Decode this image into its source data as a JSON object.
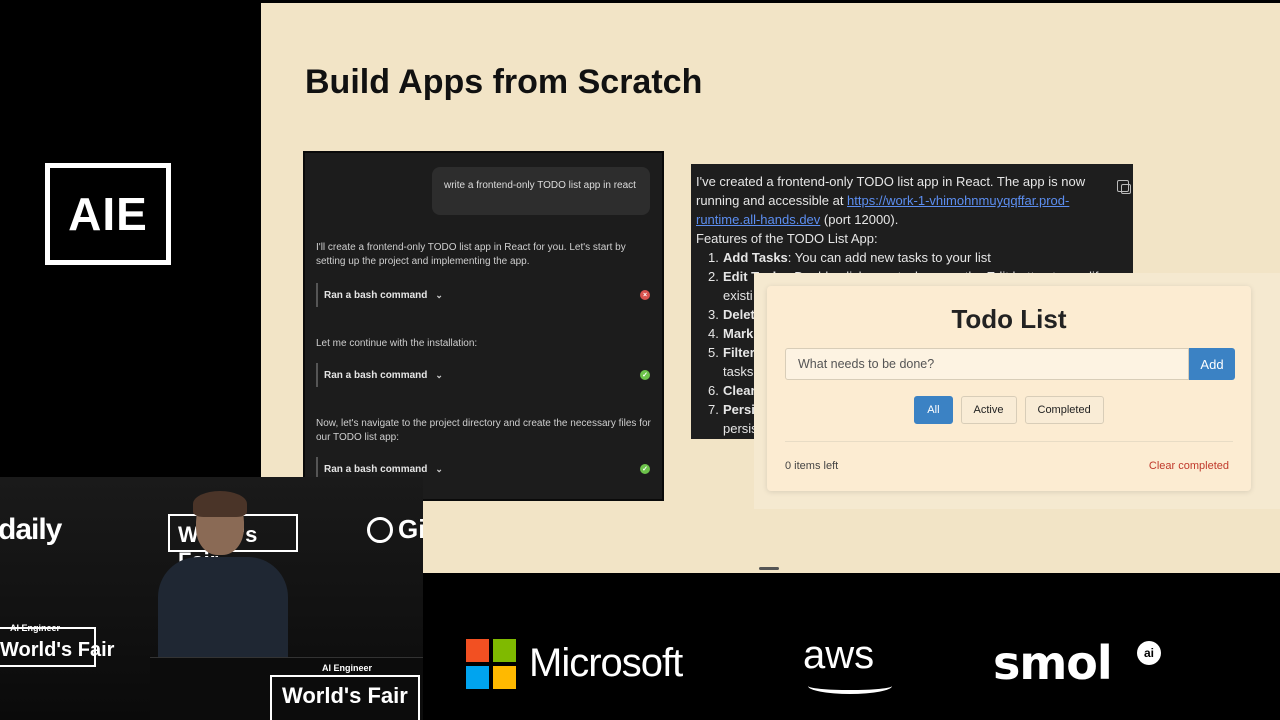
{
  "event": {
    "logo_text": "AIE"
  },
  "slide": {
    "title": "Build Apps from Scratch"
  },
  "chat": {
    "user_message": "write a frontend-only TODO list app in react",
    "messages": [
      "I'll create a frontend-only TODO list app in React for you. Let's start by setting up the project and implementing the app.",
      "Let me continue with the installation:",
      "Now, let's navigate to the project directory and create the necessary files for our TODO list app:"
    ],
    "commands": [
      {
        "label": "Ran a bash command",
        "status": "error"
      },
      {
        "label": "Ran a bash command",
        "status": "success"
      },
      {
        "label": "Ran a bash command",
        "status": "success"
      }
    ]
  },
  "response": {
    "intro_before_link": "I've created a frontend-only TODO list app in React. The app is now running and accessible at ",
    "link": "https://work-1-vhimohnmuyqqffar.prod-runtime.all-hands.dev",
    "intro_after_link": " (port 12000).",
    "features_heading": "Features of the TODO List App:",
    "features": [
      {
        "num": "1.",
        "title": "Add Tasks",
        "text": ": You can add new tasks to your list"
      },
      {
        "num": "2.",
        "title": "Edit Tasks",
        "text": ": Double-click on a task or use the Edit button to modify"
      },
      {
        "num": "3.",
        "title": "Delete Tasks",
        "text": ""
      },
      {
        "num": "4.",
        "title": "Mark Complete",
        "text": ""
      },
      {
        "num": "5.",
        "title": "Filter Tasks",
        "text": ""
      },
      {
        "num": "6.",
        "title": "Clear Completed",
        "text": ""
      },
      {
        "num": "7.",
        "title": "Persistence",
        "text": ""
      }
    ],
    "line2_cont": "existi",
    "line5_cont": "tasks",
    "line7_cont": "persis"
  },
  "todo_app": {
    "title": "Todo List",
    "input_placeholder": "What needs to be done?",
    "add_label": "Add",
    "filters": [
      "All",
      "Active",
      "Completed"
    ],
    "active_filter": "All",
    "items_left": "0 items left",
    "clear_completed": "Clear completed"
  },
  "video": {
    "daily": "daily",
    "worlds_fair": "World's Fair",
    "worlds_fair_left": "World's Fair",
    "worlds_fair_bottom": "World's Fair",
    "ai_engineer": "AI Engineer",
    "gi": "Gi"
  },
  "sponsors": {
    "microsoft": "Microsoft",
    "aws": "aws",
    "smol": "smol",
    "smol_badge": "ai"
  },
  "colors": {
    "slide_bg": "#f2e4c6",
    "accent_blue": "#3b82c4",
    "clear_red": "#c0392b",
    "ms_red": "#f25022",
    "ms_green": "#7fba00",
    "ms_blue": "#00a4ef",
    "ms_yellow": "#ffb900"
  }
}
